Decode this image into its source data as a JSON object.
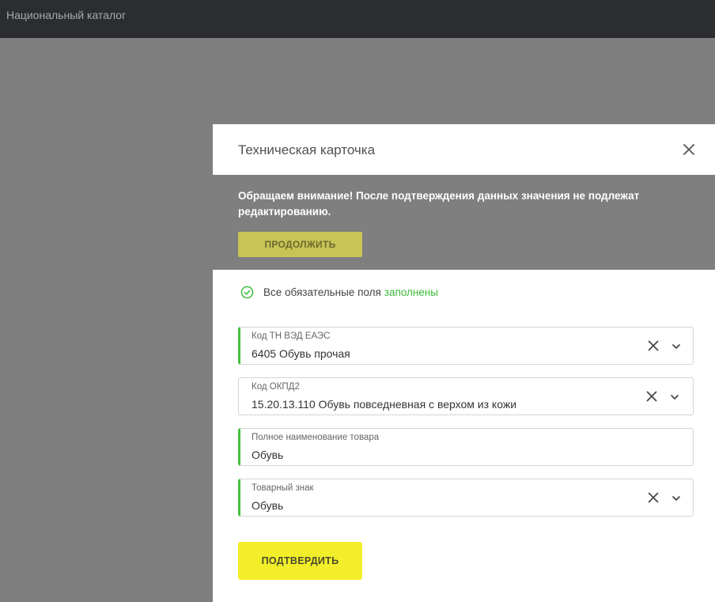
{
  "app": {
    "title": "Национальный каталог"
  },
  "modal": {
    "title": "Техническая карточка",
    "notice": {
      "text": "Обращаем внимание! После подтверждения данных значения не подлежат редактированию.",
      "continue_label": "ПРОДОЛЖИТЬ"
    },
    "status": {
      "text": "Все обязательные поля",
      "highlight": "заполнены"
    },
    "fields": [
      {
        "label": "Код ТН ВЭД ЕАЭС",
        "value": "6405 Обувь прочая"
      },
      {
        "label": "Код ОКПД2",
        "value": "15.20.13.110 Обувь повседневная с верхом из кожи"
      },
      {
        "label": "Полное наименование товара",
        "value": "Обувь"
      },
      {
        "label": "Товарный знак",
        "value": "Обувь"
      }
    ],
    "confirm_label": "ПОДТВЕРДИТЬ"
  },
  "colors": {
    "accent_green": "#46c042",
    "confirm_yellow": "#f2ef2a",
    "topbar": "#2b2d30",
    "overlay": "#7f7f7f"
  },
  "icons": [
    "close-icon",
    "check-circle-icon",
    "clear-icon",
    "chevron-down-icon"
  ]
}
